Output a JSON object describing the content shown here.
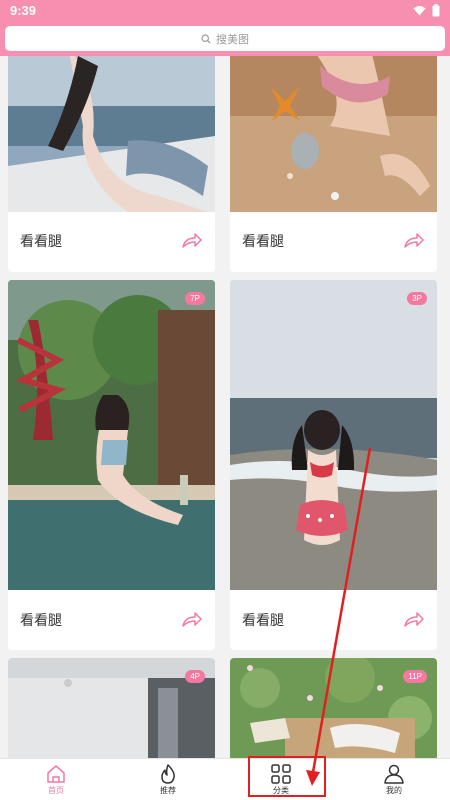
{
  "status": {
    "time": "9:39"
  },
  "search": {
    "placeholder": "搜美图"
  },
  "cards": [
    {
      "caption": "看看腿",
      "badge": ""
    },
    {
      "caption": "看看腿",
      "badge": ""
    },
    {
      "caption": "看看腿",
      "badge": "7P"
    },
    {
      "caption": "看看腿",
      "badge": "3P"
    },
    {
      "caption": "",
      "badge": "4P"
    },
    {
      "caption": "",
      "badge": "11P"
    }
  ],
  "tabs": [
    {
      "label": "首页",
      "icon": "home-icon",
      "active": true
    },
    {
      "label": "推荐",
      "icon": "flame-icon",
      "active": false
    },
    {
      "label": "分类",
      "icon": "grid-icon",
      "active": false
    },
    {
      "label": "我的",
      "icon": "user-icon",
      "active": false
    }
  ],
  "colors": {
    "brand": "#f78fb0",
    "accent": "#f5789f",
    "annotation": "#e02020"
  }
}
